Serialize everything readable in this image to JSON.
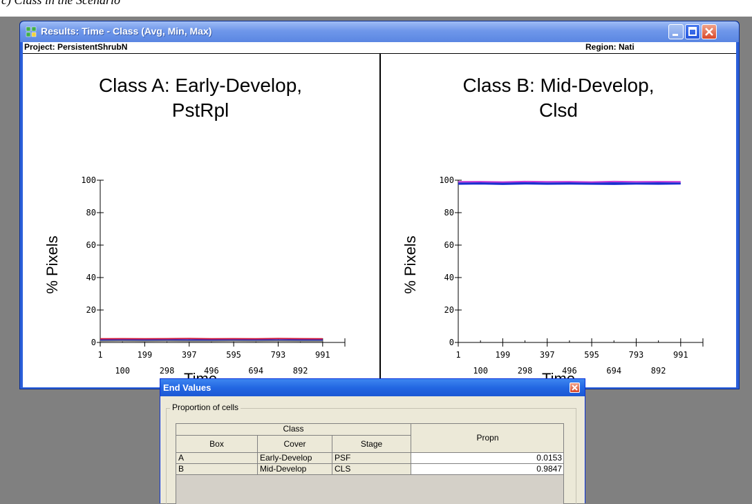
{
  "caption_fragment": "c) Class in the Scenario",
  "results_window": {
    "title": "Results: Time - Class (Avg, Min, Max)",
    "project": "Project: PersistentShrubN",
    "region": "Region: Nati"
  },
  "colors": {
    "xp_title_blue": "#2b5fd9",
    "series_blue": "#1a2fd0",
    "series_red": "#d21a3c",
    "series_magenta": "#c73bd6",
    "series_gray": "#808080"
  },
  "chart_data": [
    {
      "type": "line",
      "title": "Class A: Early-Develop, PstRpl",
      "title_lines": [
        "Class A: Early-Develop,",
        "PstRpl"
      ],
      "xlabel": "Time",
      "ylabel": "% Pixels",
      "xlim": [
        1,
        1090
      ],
      "ylim": [
        0,
        100
      ],
      "yticks": [
        0,
        20,
        40,
        60,
        80,
        100
      ],
      "xticks_top": [
        1,
        199,
        397,
        595,
        793,
        991
      ],
      "xticks_bottom": [
        100,
        298,
        496,
        694,
        892
      ],
      "grid": false,
      "x": [
        1,
        100,
        199,
        298,
        397,
        496,
        595,
        694,
        793,
        892,
        991
      ],
      "series": [
        {
          "name": "Avg",
          "color": "#1a2fd0",
          "values": [
            1.5,
            1.5,
            1.5,
            1.6,
            1.5,
            1.5,
            1.5,
            1.6,
            1.5,
            1.5,
            1.5
          ]
        },
        {
          "name": "Min",
          "color": "#808080",
          "values": [
            0.8,
            0.9,
            0.8,
            0.9,
            0.8,
            0.8,
            0.9,
            0.8,
            0.9,
            0.8,
            0.8
          ]
        },
        {
          "name": "Max",
          "color": "#d21a3c",
          "values": [
            2.2,
            2.3,
            2.2,
            2.3,
            2.4,
            2.2,
            2.3,
            2.2,
            2.4,
            2.3,
            2.2
          ]
        }
      ]
    },
    {
      "type": "line",
      "title": "Class B: Mid-Develop, Clsd",
      "title_lines": [
        "Class B: Mid-Develop,",
        "Clsd"
      ],
      "xlabel": "Time",
      "ylabel": "% Pixels",
      "xlim": [
        1,
        1090
      ],
      "ylim": [
        0,
        100
      ],
      "yticks": [
        0,
        20,
        40,
        60,
        80,
        100
      ],
      "xticks_top": [
        1,
        199,
        397,
        595,
        793,
        991
      ],
      "xticks_bottom": [
        100,
        298,
        496,
        694,
        892
      ],
      "grid": false,
      "x": [
        1,
        100,
        199,
        298,
        397,
        496,
        595,
        694,
        793,
        892,
        991
      ],
      "series": [
        {
          "name": "Avg",
          "color": "#1a2fd0",
          "values": [
            98.2,
            98.3,
            98.2,
            98.4,
            98.2,
            98.3,
            98.2,
            98.3,
            98.2,
            98.3,
            98.2
          ]
        },
        {
          "name": "Min",
          "color": "#1a2fd0",
          "values": [
            97.6,
            97.8,
            97.5,
            97.8,
            97.6,
            97.7,
            97.6,
            97.5,
            97.7,
            97.6,
            97.8
          ]
        },
        {
          "name": "Max",
          "color": "#c73bd6",
          "values": [
            99.0,
            99.1,
            98.9,
            99.2,
            99.0,
            99.1,
            98.9,
            99.2,
            99.0,
            99.1,
            99.0
          ]
        }
      ]
    }
  ],
  "end_values_dialog": {
    "title": "End Values",
    "group_caption": "Proportion of cells",
    "header_class": "Class",
    "header_box": "Box",
    "header_cover": "Cover",
    "header_stage": "Stage",
    "header_propn": "Propn",
    "rows": [
      {
        "box": "A",
        "cover": "Early-Develop",
        "stage": "PSF",
        "propn": "0.0153"
      },
      {
        "box": "B",
        "cover": "Mid-Develop",
        "stage": "CLS",
        "propn": "0.9847"
      }
    ]
  }
}
